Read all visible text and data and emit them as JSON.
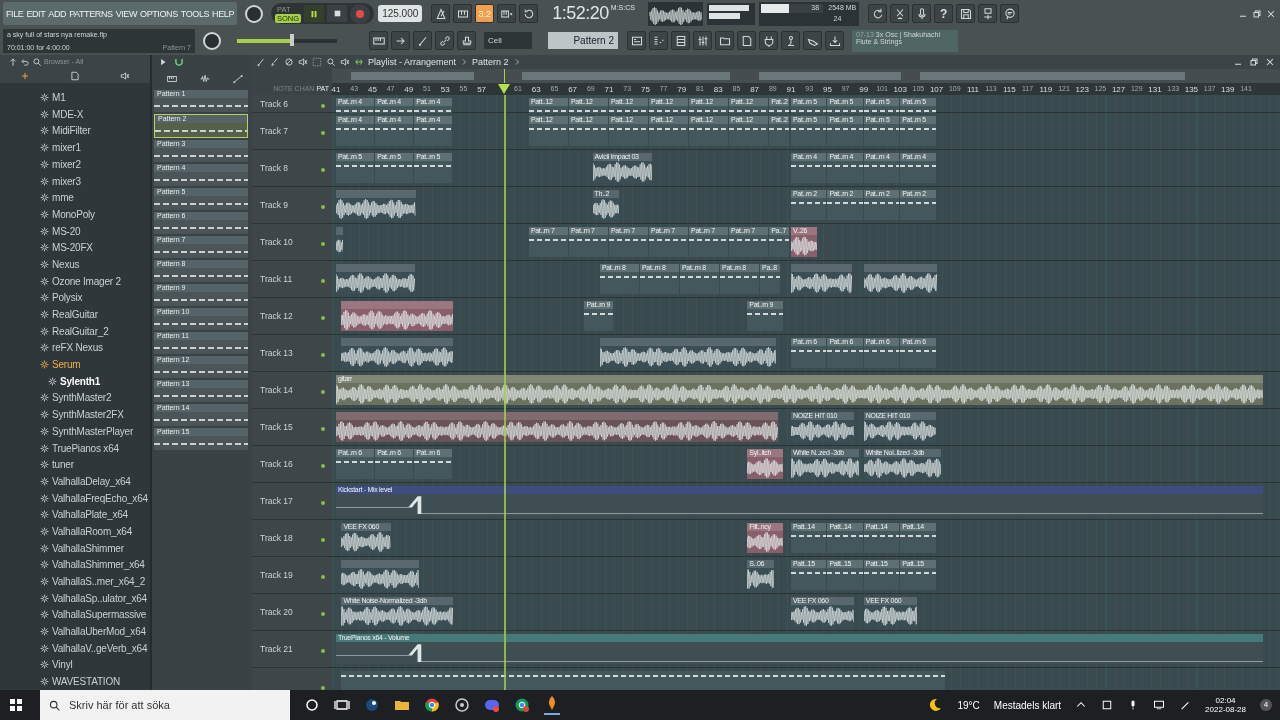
{
  "menu": [
    "FILE",
    "EDIT",
    "ADD",
    "PATTERNS",
    "VIEW",
    "OPTIONS",
    "TOOLS",
    "HELP"
  ],
  "transport": {
    "modes": [
      {
        "label": "PAT",
        "selected": false
      },
      {
        "label": "SONG",
        "selected": true
      }
    ],
    "playing": true,
    "recording": true,
    "tempo": "125.000",
    "snap": "3.2",
    "time": "1:52:20",
    "time_unit": "M:S:CS"
  },
  "help_label": "?",
  "hint": {
    "line1": "a sky full of stars nya remake.flp",
    "line2": "70:01:00 for 4:00:00",
    "pattern": "Pattern 7"
  },
  "master_volume": {
    "level": 0.55
  },
  "cpu": {
    "value": "38",
    "memory": "2548 MB",
    "polyphony": "24",
    "level": 0.45
  },
  "snap_mode": "Cell",
  "pattern_selector": "Pattern 2",
  "news": {
    "date": "07-13",
    "title": "3x Osc | Shakuhachi",
    "subtitle": "Flute & Strings"
  },
  "browser": {
    "title": "Browser - All",
    "items": [
      {
        "label": "M1",
        "selected": false,
        "loaded": false
      },
      {
        "label": "MDE-X",
        "selected": false,
        "loaded": false
      },
      {
        "label": "MidiFilter",
        "selected": false,
        "loaded": false
      },
      {
        "label": "mixer1",
        "selected": false,
        "loaded": false
      },
      {
        "label": "mixer2",
        "selected": false,
        "loaded": false
      },
      {
        "label": "mixer3",
        "selected": false,
        "loaded": false
      },
      {
        "label": "mme",
        "selected": false,
        "loaded": false
      },
      {
        "label": "MonoPoly",
        "selected": false,
        "loaded": false
      },
      {
        "label": "MS-20",
        "selected": false,
        "loaded": false
      },
      {
        "label": "MS-20FX",
        "selected": false,
        "loaded": false
      },
      {
        "label": "Nexus",
        "selected": false,
        "loaded": false
      },
      {
        "label": "Ozone Imager 2",
        "selected": false,
        "loaded": false
      },
      {
        "label": "Polysix",
        "selected": false,
        "loaded": false
      },
      {
        "label": "RealGuitar",
        "selected": false,
        "loaded": false
      },
      {
        "label": "RealGuitar_2",
        "selected": false,
        "loaded": false
      },
      {
        "label": "reFX Nexus",
        "selected": false,
        "loaded": false
      },
      {
        "label": "Serum",
        "selected": false,
        "loaded": true
      },
      {
        "label": "Sylenth1",
        "selected": true,
        "loaded": false
      },
      {
        "label": "SynthMaster2",
        "selected": false,
        "loaded": false
      },
      {
        "label": "SynthMaster2FX",
        "selected": false,
        "loaded": false
      },
      {
        "label": "SynthMasterPlayer",
        "selected": false,
        "loaded": false
      },
      {
        "label": "TruePianos x64",
        "selected": false,
        "loaded": false
      },
      {
        "label": "tuner",
        "selected": false,
        "loaded": false
      },
      {
        "label": "ValhallaDelay_x64",
        "selected": false,
        "loaded": false
      },
      {
        "label": "ValhallaFreqEcho_x64",
        "selected": false,
        "loaded": false
      },
      {
        "label": "ValhallaPlate_x64",
        "selected": false,
        "loaded": false
      },
      {
        "label": "ValhallaRoom_x64",
        "selected": false,
        "loaded": false
      },
      {
        "label": "ValhallaShimmer",
        "selected": false,
        "loaded": false
      },
      {
        "label": "ValhallaShimmer_x64",
        "selected": false,
        "loaded": false
      },
      {
        "label": "ValhallaS..mer_x64_2",
        "selected": false,
        "loaded": false
      },
      {
        "label": "ValhallaSp..ulator_x64",
        "selected": false,
        "loaded": false
      },
      {
        "label": "ValhallaSupermassive",
        "selected": false,
        "loaded": false
      },
      {
        "label": "ValhallaUberMod_x64",
        "selected": false,
        "loaded": false
      },
      {
        "label": "ValhallaV..geVerb_x64",
        "selected": false,
        "loaded": false
      },
      {
        "label": "Vinyl",
        "selected": false,
        "loaded": false
      },
      {
        "label": "WAVESTATION",
        "selected": false,
        "loaded": false
      }
    ]
  },
  "patterns": [
    {
      "label": "Pattern 1",
      "selected": false
    },
    {
      "label": "Pattern 2",
      "selected": true
    },
    {
      "label": "Pattern 3",
      "selected": false
    },
    {
      "label": "Pattern 4",
      "selected": false
    },
    {
      "label": "Pattern 5",
      "selected": false
    },
    {
      "label": "Pattern 6",
      "selected": false
    },
    {
      "label": "Pattern 7",
      "selected": false
    },
    {
      "label": "Pattern 8",
      "selected": false
    },
    {
      "label": "Pattern 9",
      "selected": false
    },
    {
      "label": "Pattern 10",
      "selected": false
    },
    {
      "label": "Pattern 11",
      "selected": false
    },
    {
      "label": "Pattern 12",
      "selected": false
    },
    {
      "label": "Pattern 13",
      "selected": false
    },
    {
      "label": "Pattern 14",
      "selected": false
    },
    {
      "label": "Pattern 15",
      "selected": false
    }
  ],
  "playlist": {
    "title": "Playlist - Arrangement",
    "pattern": "Pattern 2",
    "lane_modes": [
      {
        "label": "NOTE",
        "selected": false
      },
      {
        "label": "CHAN",
        "selected": false
      },
      {
        "label": "PAT",
        "selected": true
      }
    ],
    "ruler": [
      "41",
      "43",
      "45",
      "47",
      "49",
      "51",
      "53",
      "55",
      "57",
      "61",
      "63",
      "65",
      "67",
      "69",
      "71",
      "73",
      "75",
      "77",
      "79",
      "81",
      "83",
      "85",
      "87",
      "89",
      "91",
      "93",
      "95",
      "97",
      "99",
      "101",
      "103",
      "105",
      "107",
      "109",
      "111",
      "113",
      "115",
      "117",
      "119",
      "121",
      "123",
      "125",
      "127",
      "129",
      "131",
      "133",
      "135",
      "137",
      "139",
      "141"
    ],
    "tracks": [
      {
        "name": "Track 6",
        "clips": [
          {
            "kind": "pattern",
            "label": "Pat..rn 4"
          },
          {
            "kind": "pattern",
            "label": "Pat..rn 4"
          },
          {
            "kind": "pattern",
            "label": "Pat..rn 4"
          },
          {
            "kind": "pattern",
            "label": "Patt..12"
          },
          {
            "kind": "pattern",
            "label": "Patt..12"
          },
          {
            "kind": "pattern",
            "label": "Patt..12"
          },
          {
            "kind": "pattern",
            "label": "Patt..12"
          },
          {
            "kind": "pattern",
            "label": "Patt..12"
          },
          {
            "kind": "pattern",
            "label": "Patt..12"
          },
          {
            "kind": "pattern",
            "label": "Pat..2"
          },
          {
            "kind": "pattern",
            "label": "Pat..rn 5"
          },
          {
            "kind": "pattern",
            "label": "Pat..rn 5"
          },
          {
            "kind": "pattern",
            "label": "Pat..rn 5"
          },
          {
            "kind": "pattern",
            "label": "Pat..rn 5"
          }
        ]
      },
      {
        "name": "Track 7",
        "clips": [
          {
            "kind": "pattern",
            "label": "Pat..rn 4"
          },
          {
            "kind": "pattern",
            "label": "Pat..rn 4"
          },
          {
            "kind": "pattern",
            "label": "Pat..rn 4"
          },
          {
            "kind": "pattern",
            "label": "Patt..12"
          },
          {
            "kind": "pattern",
            "label": "Patt..12"
          },
          {
            "kind": "pattern",
            "label": "Patt..12"
          },
          {
            "kind": "pattern",
            "label": "Patt..12"
          },
          {
            "kind": "pattern",
            "label": "Patt..12"
          },
          {
            "kind": "pattern",
            "label": "Patt..12"
          },
          {
            "kind": "pattern",
            "label": "Pat..2"
          },
          {
            "kind": "pattern",
            "label": "Pat..rn 5"
          },
          {
            "kind": "pattern",
            "label": "Pat..rn 5"
          },
          {
            "kind": "pattern",
            "label": "Pat..rn 5"
          },
          {
            "kind": "pattern",
            "label": "Pat..rn 5"
          }
        ]
      },
      {
        "name": "Track 8",
        "clips": [
          {
            "kind": "pattern",
            "label": "Pat..rn 5"
          },
          {
            "kind": "pattern",
            "label": "Pat..rn 5"
          },
          {
            "kind": "pattern",
            "label": "Pat..rn 5"
          },
          {
            "kind": "audio",
            "label": "Avicii Impact 03"
          },
          {
            "kind": "pattern",
            "label": "Pat..rn 4"
          },
          {
            "kind": "pattern",
            "label": "Pat..rn 4"
          },
          {
            "kind": "pattern",
            "label": "Pat..rn 4"
          },
          {
            "kind": "pattern",
            "label": "Pat..rn 4"
          }
        ]
      },
      {
        "name": "Track 9",
        "clips": [
          {
            "kind": "audio"
          },
          {
            "kind": "audio",
            "label": "Th..2"
          },
          {
            "kind": "pattern",
            "label": "Pat..rn 2"
          },
          {
            "kind": "pattern",
            "label": "Pat..rn 2"
          },
          {
            "kind": "pattern",
            "label": "Pat..rn 2"
          },
          {
            "kind": "pattern",
            "label": "Pat..rn 2"
          }
        ]
      },
      {
        "name": "Track 10",
        "clips": [
          {
            "kind": "audio"
          },
          {
            "kind": "pattern",
            "label": "Pat..rn 7"
          },
          {
            "kind": "pattern",
            "label": "Pat..rn 7"
          },
          {
            "kind": "pattern",
            "label": "Pat..rn 7"
          },
          {
            "kind": "pattern",
            "label": "Pat..rn 7"
          },
          {
            "kind": "pattern",
            "label": "Pat..rn 7"
          },
          {
            "kind": "pattern",
            "label": "Pat..rn 7"
          },
          {
            "kind": "pattern",
            "label": "Pa..7"
          },
          {
            "kind": "audio",
            "label": "V..26",
            "color": "#8a5f6c"
          }
        ]
      },
      {
        "name": "Track 11",
        "clips": [
          {
            "kind": "audio"
          },
          {
            "kind": "pattern",
            "label": "Pat..rn 8"
          },
          {
            "kind": "pattern",
            "label": "Pat..rn 8"
          },
          {
            "kind": "pattern",
            "label": "Pat..rn 8"
          },
          {
            "kind": "pattern",
            "label": "Pat..rn 8"
          },
          {
            "kind": "pattern",
            "label": "Pa..8"
          },
          {
            "kind": "audio"
          },
          {
            "kind": "audio"
          }
        ]
      },
      {
        "name": "Track 12",
        "clips": [
          {
            "kind": "audio",
            "color": "#8a5f6c"
          },
          {
            "kind": "pattern",
            "label": "Pat..rn 9"
          },
          {
            "kind": "pattern",
            "label": "Pat..rn 9"
          }
        ]
      },
      {
        "name": "Track 13",
        "clips": [
          {
            "kind": "audio"
          },
          {
            "kind": "audio"
          },
          {
            "kind": "pattern",
            "label": "Pat..rn 6"
          },
          {
            "kind": "pattern",
            "label": "Pat..rn 6"
          },
          {
            "kind": "pattern",
            "label": "Pat..rn 6"
          },
          {
            "kind": "pattern",
            "label": "Pat..rn 6"
          }
        ]
      },
      {
        "name": "Track 14",
        "clips": [
          {
            "kind": "audio",
            "label": "gitarr",
            "color": "#6c7260"
          }
        ]
      },
      {
        "name": "Track 15",
        "clips": [
          {
            "kind": "audio",
            "color": "#6a5358"
          },
          {
            "kind": "audio",
            "label": "NOIZE HIT 010"
          },
          {
            "kind": "audio",
            "label": "NOIZE HIT 010"
          }
        ]
      },
      {
        "name": "Track 16",
        "clips": [
          {
            "kind": "pattern",
            "label": "Pat..rn 6"
          },
          {
            "kind": "pattern",
            "label": "Pat..rn 6"
          },
          {
            "kind": "pattern",
            "label": "Pat..rn 6"
          },
          {
            "kind": "audio",
            "label": "Syl..itch",
            "color": "#8a5f6c"
          },
          {
            "kind": "audio",
            "label": "White N..zed -3db"
          },
          {
            "kind": "audio",
            "label": "White Noi..lized -3db"
          }
        ]
      },
      {
        "name": "Track 17",
        "clips": [
          {
            "kind": "automation",
            "label": "Kickstart - Mix level",
            "color": "#3e4c80"
          }
        ]
      },
      {
        "name": "Track 18",
        "clips": [
          {
            "kind": "audio",
            "label": "VEE FX 060"
          },
          {
            "kind": "audio",
            "label": "Filt..ncy",
            "color": "#8a5f6c"
          },
          {
            "kind": "pattern",
            "label": "Patt..14"
          },
          {
            "kind": "pattern",
            "label": "Patt..14"
          },
          {
            "kind": "pattern",
            "label": "Patt..14"
          },
          {
            "kind": "pattern",
            "label": "Patt..14"
          }
        ]
      },
      {
        "name": "Track 19",
        "clips": [
          {
            "kind": "audio"
          },
          {
            "kind": "audio",
            "label": "S..06"
          },
          {
            "kind": "pattern",
            "label": "Patt..15"
          },
          {
            "kind": "pattern",
            "label": "Patt..15"
          },
          {
            "kind": "pattern",
            "label": "Patt..15"
          },
          {
            "kind": "pattern",
            "label": "Patt..15"
          }
        ]
      },
      {
        "name": "Track 20",
        "clips": [
          {
            "kind": "audio",
            "label": "White Noise-Normalized -3db"
          },
          {
            "kind": "audio",
            "label": "VEE FX 060"
          },
          {
            "kind": "audio",
            "label": "VEE FX 060"
          }
        ]
      },
      {
        "name": "Track 21",
        "clips": [
          {
            "kind": "automation",
            "label": "TruePianos x64 - Volume",
            "color": "#467a78"
          }
        ]
      },
      {
        "clips": [
          {
            "kind": "pattern"
          }
        ]
      }
    ]
  },
  "taskbar": {
    "search_placeholder": "Skriv här för att söka",
    "weather": "19°C",
    "weather_text": "Mestadels klart",
    "time": "02:04",
    "date": "2022-08-28",
    "notifications": "4"
  }
}
